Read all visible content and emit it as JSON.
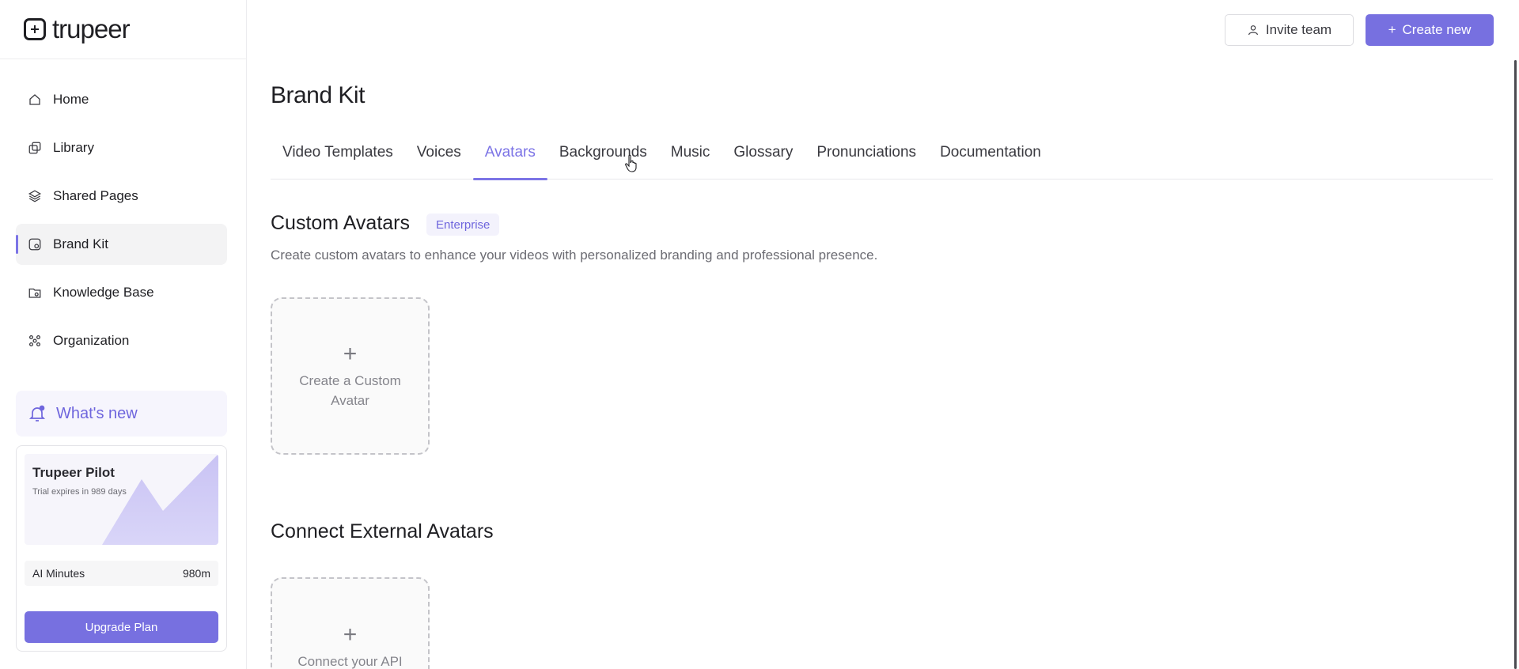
{
  "logo": {
    "text": "trupeer"
  },
  "sidebar": {
    "items": [
      {
        "label": "Home",
        "icon": "home-icon"
      },
      {
        "label": "Library",
        "icon": "library-icon"
      },
      {
        "label": "Shared Pages",
        "icon": "layers-icon"
      },
      {
        "label": "Brand Kit",
        "icon": "brand-kit-icon",
        "active": true
      },
      {
        "label": "Knowledge Base",
        "icon": "folder-icon"
      },
      {
        "label": "Organization",
        "icon": "organization-icon"
      }
    ],
    "whats_new": "What's new",
    "pilot": {
      "title": "Trupeer Pilot",
      "subtitle": "Trial expires in 989 days",
      "minutes_label": "AI Minutes",
      "minutes_value": "980m",
      "upgrade_label": "Upgrade Plan"
    }
  },
  "header": {
    "invite_label": "Invite team",
    "create_label": "Create new"
  },
  "main": {
    "title": "Brand Kit",
    "tabs": [
      {
        "label": "Video Templates"
      },
      {
        "label": "Voices"
      },
      {
        "label": "Avatars",
        "active": true
      },
      {
        "label": "Backgrounds"
      },
      {
        "label": "Music"
      },
      {
        "label": "Glossary"
      },
      {
        "label": "Pronunciations"
      },
      {
        "label": "Documentation"
      }
    ],
    "custom": {
      "title": "Custom Avatars",
      "badge": "Enterprise",
      "description": "Create custom avatars to enhance your videos with personalized branding and professional presence.",
      "card_label": "Create a Custom Avatar"
    },
    "external": {
      "title": "Connect External Avatars",
      "card_label": "Connect your API"
    }
  },
  "colors": {
    "accent": "#7770e0",
    "active_tab": "#7c74e6",
    "badge_bg": "#f3f2fc"
  }
}
